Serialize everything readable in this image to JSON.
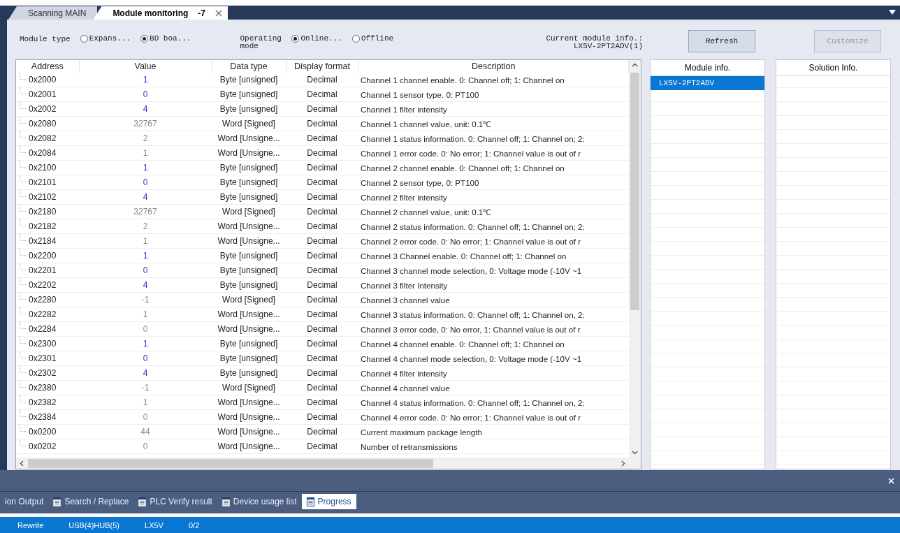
{
  "doc_tabs": [
    {
      "label": "Scanning MAIN",
      "selected": false
    },
    {
      "label": "Module monitoring",
      "suffix": "-7",
      "selected": true,
      "closable": true
    }
  ],
  "options": {
    "module_type_label": "Module type",
    "module_types": [
      {
        "label": "Expans...",
        "selected": false
      },
      {
        "label": "BD boa...",
        "selected": true
      }
    ],
    "mode_label": "Operating mode",
    "modes": [
      {
        "label": "Online...",
        "selected": true
      },
      {
        "label": "Offline",
        "selected": false
      }
    ],
    "current_info_label": "Current module info.:",
    "current_info_value": "LX5V-2PT2ADV(1)"
  },
  "buttons": [
    {
      "label": "Refresh",
      "disabled": false
    },
    {
      "label": "Customize",
      "disabled": true
    }
  ],
  "table": {
    "columns": [
      "Address",
      "Value",
      "Data type",
      "Display format",
      "Description"
    ],
    "rows": [
      {
        "address": "0x2000",
        "value": "1",
        "writable": true,
        "data_type": "Byte [unsigned]",
        "format": "Decimal",
        "description": "Channel 1 channel enable. 0: Channel off; 1: Channel on"
      },
      {
        "address": "0x2001",
        "value": "0",
        "writable": true,
        "data_type": "Byte [unsigned]",
        "format": "Decimal",
        "description": "Channel 1 sensor type. 0: PT100"
      },
      {
        "address": "0x2002",
        "value": "4",
        "writable": true,
        "data_type": "Byte [unsigned]",
        "format": "Decimal",
        "description": "Channel 1 filter intensity"
      },
      {
        "address": "0x2080",
        "value": "32767",
        "writable": false,
        "data_type": "Word [Signed]",
        "format": "Decimal",
        "description": "Channel 1 channel value, unit: 0.1℃"
      },
      {
        "address": "0x2082",
        "value": "2",
        "writable": false,
        "data_type": "Word [Unsigne...",
        "format": "Decimal",
        "description": "Channel 1 status information. 0: Channel off; 1: Channel on; 2:"
      },
      {
        "address": "0x2084",
        "value": "1",
        "writable": false,
        "data_type": "Word [Unsigne...",
        "format": "Decimal",
        "description": "Channel 1 error code. 0: No error; 1: Channel value is out of r"
      },
      {
        "address": "0x2100",
        "value": "1",
        "writable": true,
        "data_type": "Byte [unsigned]",
        "format": "Decimal",
        "description": "Channel 2 channel enable. 0: Channel off; 1: Channel on"
      },
      {
        "address": "0x2101",
        "value": "0",
        "writable": true,
        "data_type": "Byte [unsigned]",
        "format": "Decimal",
        "description": "Channel 2 sensor type, 0: PT100"
      },
      {
        "address": "0x2102",
        "value": "4",
        "writable": true,
        "data_type": "Byte [unsigned]",
        "format": "Decimal",
        "description": "Channel 2 filter intensity"
      },
      {
        "address": "0x2180",
        "value": "32767",
        "writable": false,
        "data_type": "Word [Signed]",
        "format": "Decimal",
        "description": "Channel 2 channel value, unit: 0.1℃"
      },
      {
        "address": "0x2182",
        "value": "2",
        "writable": false,
        "data_type": "Word [Unsigne...",
        "format": "Decimal",
        "description": "Channel 2 status information. 0: Channel off; 1: Channel on; 2:"
      },
      {
        "address": "0x2184",
        "value": "1",
        "writable": false,
        "data_type": "Word [Unsigne...",
        "format": "Decimal",
        "description": "Channel 2 error code. 0: No error; 1: Channel value is out of r"
      },
      {
        "address": "0x2200",
        "value": "1",
        "writable": true,
        "data_type": "Byte [unsigned]",
        "format": "Decimal",
        "description": "Channel 3 Channel enable. 0: Channel off; 1: Channel on"
      },
      {
        "address": "0x2201",
        "value": "0",
        "writable": true,
        "data_type": "Byte [unsigned]",
        "format": "Decimal",
        "description": "Channel 3 channel mode selection, 0: Voltage mode (-10V ~1"
      },
      {
        "address": "0x2202",
        "value": "4",
        "writable": true,
        "data_type": "Byte [unsigned]",
        "format": "Decimal",
        "description": "Channel 3 filter Intensity"
      },
      {
        "address": "0x2280",
        "value": "-1",
        "writable": false,
        "data_type": "Word [Signed]",
        "format": "Decimal",
        "description": "Channel 3 channel value"
      },
      {
        "address": "0x2282",
        "value": "1",
        "writable": false,
        "data_type": "Word [Unsigne...",
        "format": "Decimal",
        "description": "Channel 3 status information. 0: Channel off; 1: Channel on, 2:"
      },
      {
        "address": "0x2284",
        "value": "0",
        "writable": false,
        "data_type": "Word [Unsigne...",
        "format": "Decimal",
        "description": "Channel 3 error code, 0: No error, 1: Channel value is out of r"
      },
      {
        "address": "0x2300",
        "value": "1",
        "writable": true,
        "data_type": "Byte [unsigned]",
        "format": "Decimal",
        "description": "Channel 4 channel enable. 0: Channel off; 1: Channel on"
      },
      {
        "address": "0x2301",
        "value": "0",
        "writable": true,
        "data_type": "Byte [unsigned]",
        "format": "Decimal",
        "description": "Channel 4 channel mode selection, 0: Voltage mode (-10V ~1"
      },
      {
        "address": "0x2302",
        "value": "4",
        "writable": true,
        "data_type": "Byte [unsigned]",
        "format": "Decimal",
        "description": "Channel 4 filter intensity"
      },
      {
        "address": "0x2380",
        "value": "-1",
        "writable": false,
        "data_type": "Word [Signed]",
        "format": "Decimal",
        "description": "Channel 4 channel value"
      },
      {
        "address": "0x2382",
        "value": "1",
        "writable": false,
        "data_type": "Word [Unsigne...",
        "format": "Decimal",
        "description": "Channel 4 status information. 0: Channel off; 1: Channel on, 2:"
      },
      {
        "address": "0x2384",
        "value": "0",
        "writable": false,
        "data_type": "Word [Unsigne...",
        "format": "Decimal",
        "description": "Channel 4 error code. 0: No error; 1: Channel value is out of r"
      },
      {
        "address": "0x0200",
        "value": "44",
        "writable": false,
        "data_type": "Word [Unsigne...",
        "format": "Decimal",
        "description": "Current maximum package length"
      },
      {
        "address": "0x0202",
        "value": "0",
        "writable": false,
        "data_type": "Word [Unsigne...",
        "format": "Decimal",
        "description": "Number of retransmissions"
      }
    ]
  },
  "module_info": {
    "title": "Module info.",
    "items": [
      {
        "label": "LX5V-2PT2ADV",
        "selected": true
      }
    ]
  },
  "solution_info": {
    "title": "Solution Info."
  },
  "output_tabs": [
    {
      "label": "ion Output",
      "icon": false,
      "selected": false
    },
    {
      "label": "Search / Replace",
      "icon": true,
      "selected": false
    },
    {
      "label": "PLC Verify result",
      "icon": true,
      "selected": false
    },
    {
      "label": "Device usage list",
      "icon": true,
      "selected": false
    },
    {
      "label": "Progress",
      "icon": true,
      "selected": true
    }
  ],
  "status_bar": [
    "Rewrite",
    "USB(4)HUB(5)",
    "LX5V",
    "0/2"
  ]
}
